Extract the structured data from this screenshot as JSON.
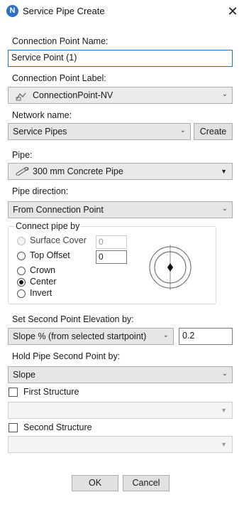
{
  "window": {
    "title": "Service Pipe Create",
    "logo_letter": "N",
    "close_glyph": "✕"
  },
  "connection_point_name": {
    "label": "Connection Point Name:",
    "value": "Service Point (1)"
  },
  "connection_point_label": {
    "label": "Connection Point Label:",
    "value": "ConnectionPoint-NV"
  },
  "network_name": {
    "label": "Network name:",
    "value": "Service Pipes",
    "create_button": "Create"
  },
  "pipe": {
    "label": "Pipe:",
    "value": "300 mm Concrete Pipe"
  },
  "pipe_direction": {
    "label": "Pipe direction:",
    "value": "From Connection Point"
  },
  "connect_pipe_by": {
    "title": "Connect pipe by",
    "options": [
      {
        "label": "Surface Cover",
        "selected": false,
        "enabled": false,
        "value": "0"
      },
      {
        "label": "Top Offset",
        "selected": false,
        "enabled": true,
        "value": "0"
      },
      {
        "label": "Crown",
        "selected": false,
        "enabled": true
      },
      {
        "label": "Center",
        "selected": true,
        "enabled": true
      },
      {
        "label": "Invert",
        "selected": false,
        "enabled": true
      }
    ]
  },
  "second_point_elevation": {
    "label": "Set Second Point Elevation by:",
    "value": "Slope % (from selected startpoint)",
    "number": "0.2"
  },
  "hold_second_point": {
    "label": "Hold Pipe Second Point by:",
    "value": "Slope"
  },
  "first_structure": {
    "label": "First Structure",
    "checked": false,
    "value": ""
  },
  "second_structure": {
    "label": "Second Structure",
    "checked": false,
    "value": ""
  },
  "buttons": {
    "ok": "OK",
    "cancel": "Cancel"
  },
  "colors": {
    "accent": "#1e73c8",
    "logo": "#2f6fc4",
    "combo_bg": "#e6e6e6"
  }
}
